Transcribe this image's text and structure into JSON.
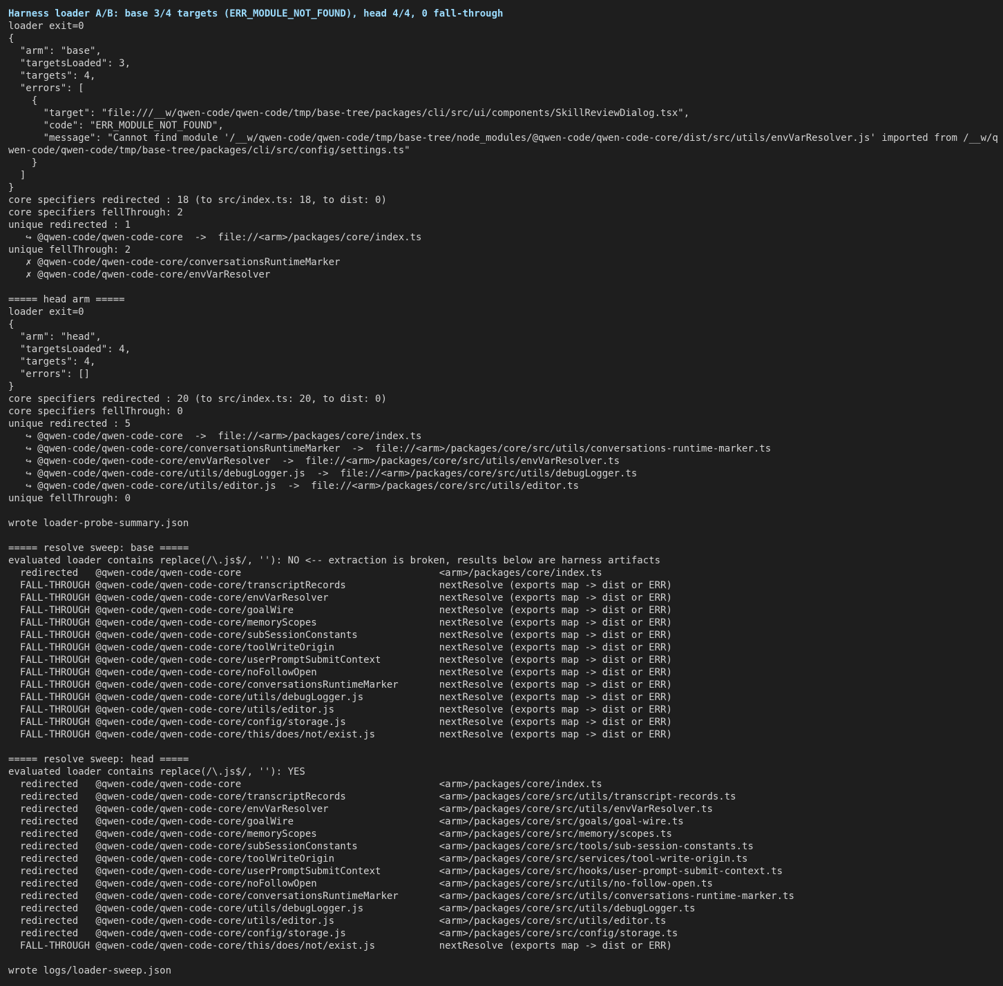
{
  "colors": {
    "background": "#1e1e1e",
    "text": "#d4d4d4",
    "header": "#9cdcfe"
  },
  "terminal": {
    "lines": [
      "Harness loader A/B: base 3/4 targets (ERR_MODULE_NOT_FOUND), head 4/4, 0 fall-through",
      "loader exit=0",
      "{",
      "  \"arm\": \"base\",",
      "  \"targetsLoaded\": 3,",
      "  \"targets\": 4,",
      "  \"errors\": [",
      "    {",
      "      \"target\": \"file:///__w/qwen-code/qwen-code/tmp/base-tree/packages/cli/src/ui/components/SkillReviewDialog.tsx\",",
      "      \"code\": \"ERR_MODULE_NOT_FOUND\",",
      "      \"message\": \"Cannot find module '/__w/qwen-code/qwen-code/tmp/base-tree/node_modules/@qwen-code/qwen-code-core/dist/src/utils/envVarResolver.js' imported from /__w/q",
      "wen-code/qwen-code/tmp/base-tree/packages/cli/src/config/settings.ts\"",
      "    }",
      "  ]",
      "}",
      "core specifiers redirected : 18 (to src/index.ts: 18, to dist: 0)",
      "core specifiers fellThrough: 2",
      "unique redirected : 1",
      "   ↪ @qwen-code/qwen-code-core  ->  file://<arm>/packages/core/index.ts",
      "unique fellThrough: 2",
      "   ✗ @qwen-code/qwen-code-core/conversationsRuntimeMarker",
      "   ✗ @qwen-code/qwen-code-core/envVarResolver",
      "",
      "===== head arm =====",
      "loader exit=0",
      "{",
      "  \"arm\": \"head\",",
      "  \"targetsLoaded\": 4,",
      "  \"targets\": 4,",
      "  \"errors\": []",
      "}",
      "core specifiers redirected : 20 (to src/index.ts: 20, to dist: 0)",
      "core specifiers fellThrough: 0",
      "unique redirected : 5",
      "   ↪ @qwen-code/qwen-code-core  ->  file://<arm>/packages/core/index.ts",
      "   ↪ @qwen-code/qwen-code-core/conversationsRuntimeMarker  ->  file://<arm>/packages/core/src/utils/conversations-runtime-marker.ts",
      "   ↪ @qwen-code/qwen-code-core/envVarResolver  ->  file://<arm>/packages/core/src/utils/envVarResolver.ts",
      "   ↪ @qwen-code/qwen-code-core/utils/debugLogger.js  ->  file://<arm>/packages/core/src/utils/debugLogger.ts",
      "   ↪ @qwen-code/qwen-code-core/utils/editor.js  ->  file://<arm>/packages/core/src/utils/editor.ts",
      "unique fellThrough: 0",
      "",
      "wrote loader-probe-summary.json",
      "",
      "===== resolve sweep: base =====",
      "evaluated loader contains replace(/\\.js$/, ''): NO <-- extraction is broken, results below are harness artifacts",
      "  redirected   @qwen-code/qwen-code-core                                  <arm>/packages/core/index.ts",
      "  FALL-THROUGH @qwen-code/qwen-code-core/transcriptRecords                nextResolve (exports map -> dist or ERR)",
      "  FALL-THROUGH @qwen-code/qwen-code-core/envVarResolver                   nextResolve (exports map -> dist or ERR)",
      "  FALL-THROUGH @qwen-code/qwen-code-core/goalWire                         nextResolve (exports map -> dist or ERR)",
      "  FALL-THROUGH @qwen-code/qwen-code-core/memoryScopes                     nextResolve (exports map -> dist or ERR)",
      "  FALL-THROUGH @qwen-code/qwen-code-core/subSessionConstants              nextResolve (exports map -> dist or ERR)",
      "  FALL-THROUGH @qwen-code/qwen-code-core/toolWriteOrigin                  nextResolve (exports map -> dist or ERR)",
      "  FALL-THROUGH @qwen-code/qwen-code-core/userPromptSubmitContext          nextResolve (exports map -> dist or ERR)",
      "  FALL-THROUGH @qwen-code/qwen-code-core/noFollowOpen                     nextResolve (exports map -> dist or ERR)",
      "  FALL-THROUGH @qwen-code/qwen-code-core/conversationsRuntimeMarker       nextResolve (exports map -> dist or ERR)",
      "  FALL-THROUGH @qwen-code/qwen-code-core/utils/debugLogger.js             nextResolve (exports map -> dist or ERR)",
      "  FALL-THROUGH @qwen-code/qwen-code-core/utils/editor.js                  nextResolve (exports map -> dist or ERR)",
      "  FALL-THROUGH @qwen-code/qwen-code-core/config/storage.js                nextResolve (exports map -> dist or ERR)",
      "  FALL-THROUGH @qwen-code/qwen-code-core/this/does/not/exist.js           nextResolve (exports map -> dist or ERR)",
      "",
      "===== resolve sweep: head =====",
      "evaluated loader contains replace(/\\.js$/, ''): YES",
      "  redirected   @qwen-code/qwen-code-core                                  <arm>/packages/core/index.ts",
      "  redirected   @qwen-code/qwen-code-core/transcriptRecords                <arm>/packages/core/src/utils/transcript-records.ts",
      "  redirected   @qwen-code/qwen-code-core/envVarResolver                   <arm>/packages/core/src/utils/envVarResolver.ts",
      "  redirected   @qwen-code/qwen-code-core/goalWire                         <arm>/packages/core/src/goals/goal-wire.ts",
      "  redirected   @qwen-code/qwen-code-core/memoryScopes                     <arm>/packages/core/src/memory/scopes.ts",
      "  redirected   @qwen-code/qwen-code-core/subSessionConstants              <arm>/packages/core/src/tools/sub-session-constants.ts",
      "  redirected   @qwen-code/qwen-code-core/toolWriteOrigin                  <arm>/packages/core/src/services/tool-write-origin.ts",
      "  redirected   @qwen-code/qwen-code-core/userPromptSubmitContext          <arm>/packages/core/src/hooks/user-prompt-submit-context.ts",
      "  redirected   @qwen-code/qwen-code-core/noFollowOpen                     <arm>/packages/core/src/utils/no-follow-open.ts",
      "  redirected   @qwen-code/qwen-code-core/conversationsRuntimeMarker       <arm>/packages/core/src/utils/conversations-runtime-marker.ts",
      "  redirected   @qwen-code/qwen-code-core/utils/debugLogger.js             <arm>/packages/core/src/utils/debugLogger.ts",
      "  redirected   @qwen-code/qwen-code-core/utils/editor.js                  <arm>/packages/core/src/utils/editor.ts",
      "  redirected   @qwen-code/qwen-code-core/config/storage.js                <arm>/packages/core/src/config/storage.ts",
      "  FALL-THROUGH @qwen-code/qwen-code-core/this/does/not/exist.js           nextResolve (exports map -> dist or ERR)",
      "",
      "wrote logs/loader-sweep.json"
    ]
  }
}
